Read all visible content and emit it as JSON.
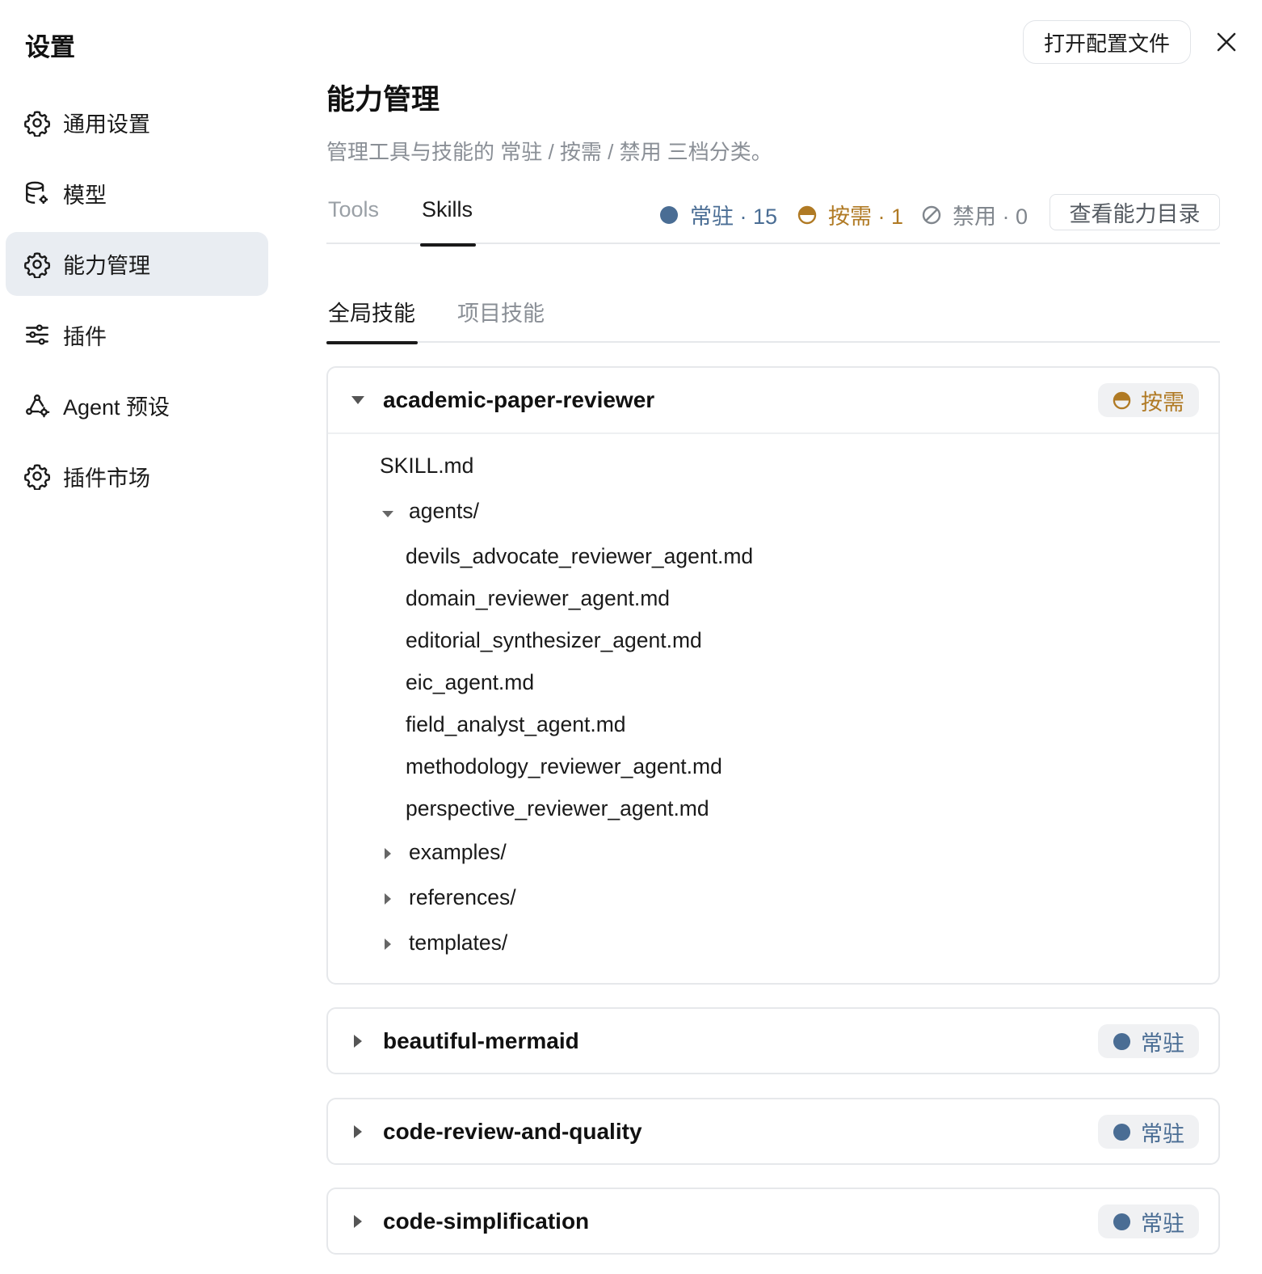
{
  "sidebar": {
    "title": "设置",
    "items": [
      {
        "label": "通用设置",
        "icon": "gear-icon"
      },
      {
        "label": "模型",
        "icon": "database-gear-icon"
      },
      {
        "label": "能力管理",
        "icon": "gear-icon"
      },
      {
        "label": "插件",
        "icon": "sliders-icon"
      },
      {
        "label": "Agent 预设",
        "icon": "agent-gear-icon"
      },
      {
        "label": "插件市场",
        "icon": "gear-icon"
      }
    ],
    "active_item": "能力管理"
  },
  "header": {
    "open_config_label": "打开配置文件",
    "close_icon": "close-icon"
  },
  "main": {
    "title": "能力管理",
    "description": "管理工具与技能的 常驻 / 按需 / 禁用 三档分类。",
    "tabs": [
      {
        "label": "Tools"
      },
      {
        "label": "Skills"
      }
    ],
    "active_tab": "Skills",
    "stats": {
      "resident": "常驻 · 15",
      "ondemand": "按需 · 1",
      "disabled": "禁用 · 0"
    },
    "catalog_button": "查看能力目录",
    "subtabs": [
      {
        "label": "全局技能"
      },
      {
        "label": "项目技能"
      }
    ],
    "active_subtab": "全局技能"
  },
  "skills": [
    {
      "name": "academic-paper-reviewer",
      "status": "按需",
      "expanded": true,
      "tree": {
        "file": "SKILL.md",
        "open_folder": "agents/",
        "children": [
          "devils_advocate_reviewer_agent.md",
          "domain_reviewer_agent.md",
          "editorial_synthesizer_agent.md",
          "eic_agent.md",
          "field_analyst_agent.md",
          "methodology_reviewer_agent.md",
          "perspective_reviewer_agent.md"
        ],
        "closed_folders": [
          "examples/",
          "references/",
          "templates/"
        ]
      }
    },
    {
      "name": "beautiful-mermaid",
      "status": "常驻",
      "expanded": false
    },
    {
      "name": "code-review-and-quality",
      "status": "常驻",
      "expanded": false
    },
    {
      "name": "code-simplification",
      "status": "常驻",
      "expanded": false
    }
  ],
  "colors": {
    "resident": "#4a6d94",
    "ondemand": "#b07a24",
    "disabled": "#80868d",
    "active_nav_bg": "#e9edf2"
  }
}
